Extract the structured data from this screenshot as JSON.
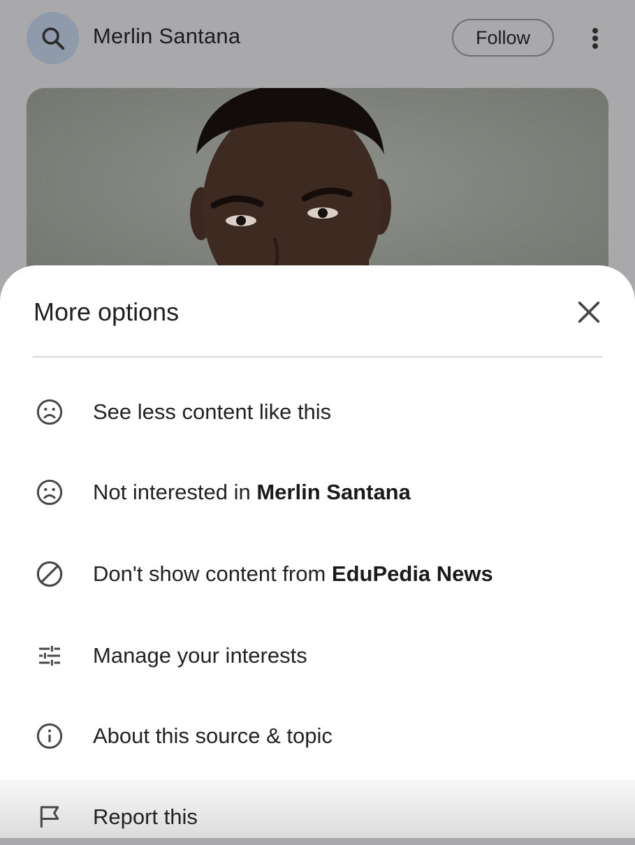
{
  "header": {
    "topic_title": "Merlin Santana",
    "follow_label": "Follow"
  },
  "sheet": {
    "title": "More options",
    "items": [
      {
        "icon": "sad-face-icon",
        "label": "See less content like this",
        "bold": ""
      },
      {
        "icon": "sad-face-icon",
        "label": "Not interested in ",
        "bold": "Merlin Santana"
      },
      {
        "icon": "block-icon",
        "label": "Don't show content from ",
        "bold": "EduPedia News"
      },
      {
        "icon": "tune-icon",
        "label": "Manage your interests",
        "bold": ""
      },
      {
        "icon": "info-icon",
        "label": "About this source & topic",
        "bold": ""
      },
      {
        "icon": "flag-icon",
        "label": "Report this",
        "bold": ""
      }
    ]
  }
}
